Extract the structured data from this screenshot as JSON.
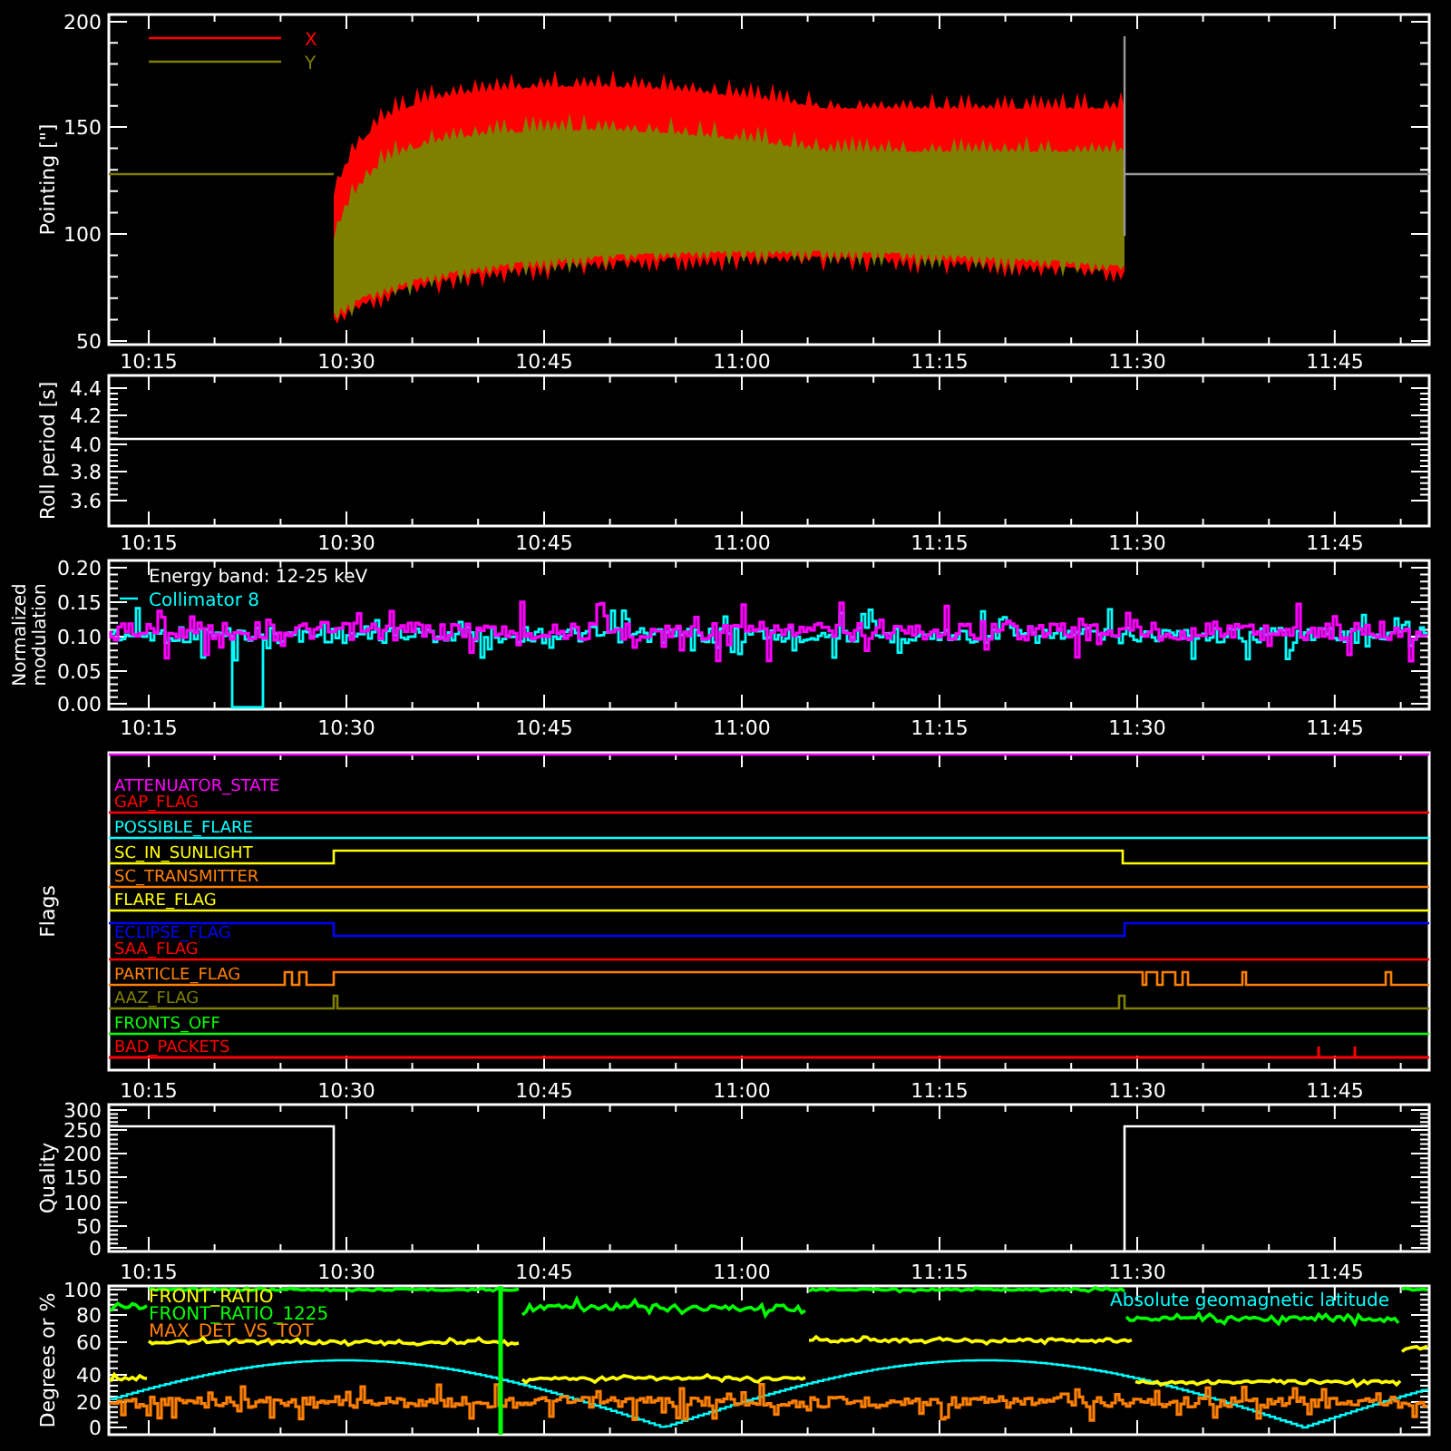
{
  "panels": [
    {
      "kind": "pointing",
      "ylabel": "Pointing [\"]",
      "yticks": [
        "200",
        "150",
        "100",
        "50"
      ],
      "legend": [
        {
          "label": "X",
          "color": "#ff0000"
        },
        {
          "label": "Y",
          "color": "#808000"
        }
      ],
      "time_labels": [
        "10:15",
        "10:30",
        "10:45",
        "11:00",
        "11:15",
        "11:30",
        "11:45"
      ]
    },
    {
      "kind": "roll",
      "ylabel": "Roll period [s]",
      "yticks": [
        "4.4",
        "4.2",
        "4.0",
        "3.8",
        "3.6"
      ],
      "time_labels": [
        "10:15",
        "10:30",
        "10:45",
        "11:00",
        "11:15",
        "11:30",
        "11:45"
      ]
    },
    {
      "kind": "modulation",
      "ylabel": "Normalized",
      "ylabel_2": "modulation",
      "yticks": [
        "0.20",
        "0.15",
        "0.10",
        "0.05",
        "0.00"
      ],
      "note": "Energy band: 12-25 keV",
      "legend": [
        {
          "label": "Collimator 8",
          "color": "#00ffff"
        }
      ],
      "time_labels": [
        "10:15",
        "10:30",
        "10:45",
        "11:00",
        "11:15",
        "11:30",
        "11:45"
      ]
    },
    {
      "kind": "flags",
      "ylabel": "Flags",
      "flags": [
        {
          "label": "ATTENUATOR_STATE",
          "color": "#ff00ff"
        },
        {
          "label": "GAP_FLAG",
          "color": "#ff0000"
        },
        {
          "label": "POSSIBLE_FLARE",
          "color": "#00ffff"
        },
        {
          "label": "SC_IN_SUNLIGHT",
          "color": "#ffff00"
        },
        {
          "label": "SC_TRANSMITTER",
          "color": "#ff8000"
        },
        {
          "label": "FLARE_FLAG",
          "color": "#ffff00"
        },
        {
          "label": "ECLIPSE_FLAG",
          "color": "#0000ff"
        },
        {
          "label": "SAA_FLAG",
          "color": "#ff0000"
        },
        {
          "label": "PARTICLE_FLAG",
          "color": "#ff8000"
        },
        {
          "label": "AAZ_FLAG",
          "color": "#808000"
        },
        {
          "label": "FRONTS_OFF",
          "color": "#00ff00"
        },
        {
          "label": "BAD_PACKETS",
          "color": "#ff0000"
        }
      ],
      "time_labels": [
        "10:15",
        "10:30",
        "10:45",
        "11:00",
        "11:15",
        "11:30",
        "11:45"
      ]
    },
    {
      "kind": "quality",
      "ylabel": "Quality",
      "yticks": [
        "300",
        "250",
        "200",
        "150",
        "100",
        "50",
        "0"
      ],
      "time_labels": [
        "10:15",
        "10:30",
        "10:45",
        "11:00",
        "11:15",
        "11:30",
        "11:45"
      ]
    },
    {
      "kind": "ratios",
      "ylabel": "Degrees or %",
      "yticks": [
        "100",
        "80",
        "60",
        "40",
        "20",
        "0"
      ],
      "legend": [
        {
          "label": "FRONT_RATIO",
          "color": "#ffff00"
        },
        {
          "label": "FRONT_RATIO_1225",
          "color": "#00ff00"
        },
        {
          "label": "MAX_DET_VS_TOT",
          "color": "#ff8000"
        },
        {
          "label": "Absolute geomagnetic latitude",
          "color": "#00ffff"
        }
      ]
    }
  ]
}
